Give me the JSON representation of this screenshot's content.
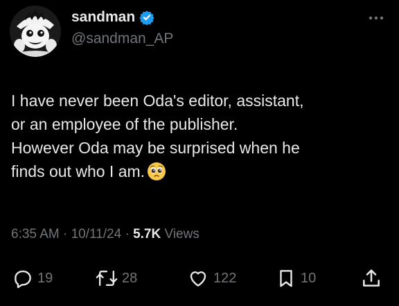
{
  "author": {
    "display_name": "sandman",
    "handle": "@sandman_AP",
    "avatar_icon": "anime-character-avatar",
    "verified_icon": "verified-badge-icon",
    "verified_color": "#1d9bf0"
  },
  "more_icon": "more-dots-icon",
  "tweet": {
    "lines": [
      "I have never been Oda's editor, assistant,",
      "or an employee of the publisher.",
      "However Oda may be surprised when he",
      "finds out who I am."
    ],
    "emoji": "pleading-face-emoji"
  },
  "meta": {
    "time": "6:35 AM",
    "separator": "·",
    "date": "10/11/24",
    "views_count": "5.7K",
    "views_label": "Views"
  },
  "actions": {
    "reply": {
      "icon": "reply-icon",
      "count": "19"
    },
    "repost": {
      "icon": "repost-icon",
      "count": "28"
    },
    "like": {
      "icon": "heart-icon",
      "count": "122"
    },
    "bookmark": {
      "icon": "bookmark-icon",
      "count": "10"
    },
    "share": {
      "icon": "share-icon"
    }
  },
  "colors": {
    "background": "#000000",
    "text_primary": "#e7e9ea",
    "text_secondary": "#71767b"
  }
}
